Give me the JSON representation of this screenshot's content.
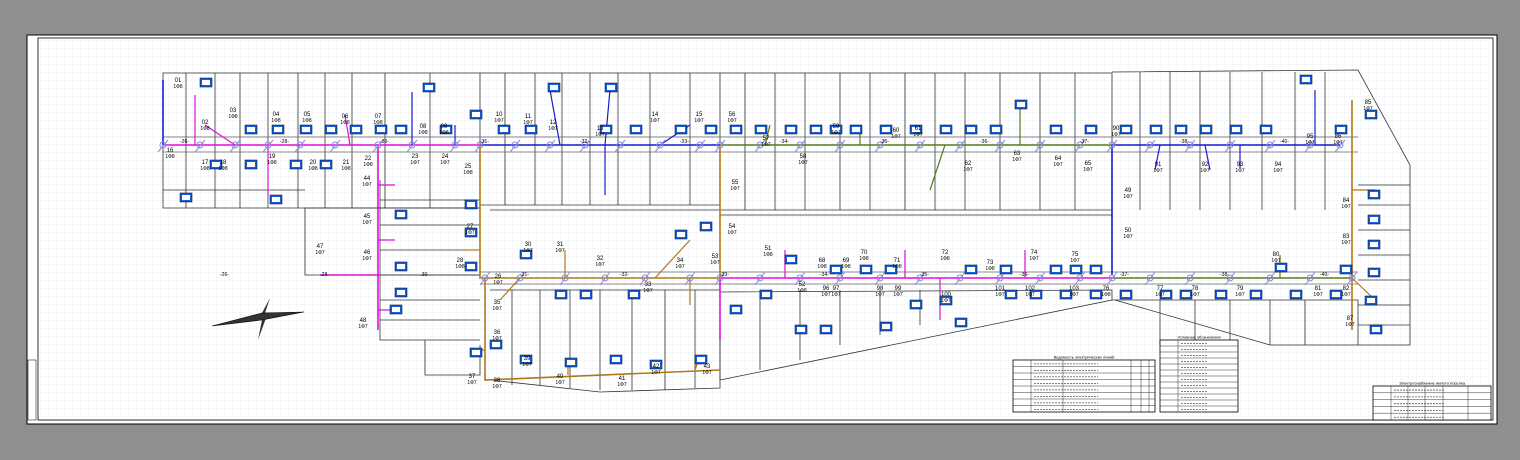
{
  "colors": {
    "background": "#8f8f8f",
    "sheet": "#ffffff",
    "grid": "#dfe6ee",
    "line_0_4kv_a": "#e010d8",
    "line_0_4kv_b": "#1a1ad0",
    "line_0_4kv_c": "#b07818",
    "line_0_4kv_d": "#5a7a1c",
    "meter_box": "#1560e0",
    "pole": "#8a8ad8"
  },
  "plots": {
    "top_left": [
      {
        "num": "01",
        "type": "1Ф8"
      },
      {
        "num": "02",
        "type": "1Ф8"
      },
      {
        "num": "03",
        "type": "1Ф8"
      },
      {
        "num": "04",
        "type": "1Ф8"
      },
      {
        "num": "05",
        "type": "1Ф8"
      },
      {
        "num": "06",
        "type": "1Ф8"
      },
      {
        "num": "07",
        "type": "1Ф8"
      },
      {
        "num": "08",
        "type": "1Ф8"
      },
      {
        "num": "09",
        "type": "1Ф8"
      },
      {
        "num": "10",
        "type": "1Ф7"
      },
      {
        "num": "11",
        "type": "1Ф7"
      },
      {
        "num": "12",
        "type": "1Ф7"
      },
      {
        "num": "13",
        "type": "1Ф7"
      },
      {
        "num": "14",
        "type": "1Ф7"
      },
      {
        "num": "15",
        "type": "1Ф7"
      }
    ],
    "mid_left": [
      {
        "num": "16",
        "type": "1Ф8"
      },
      {
        "num": "17",
        "type": "1Ф8"
      },
      {
        "num": "18",
        "type": "1Ф8"
      },
      {
        "num": "19",
        "type": "1Ф8"
      },
      {
        "num": "20",
        "type": "1Ф8"
      },
      {
        "num": "21",
        "type": "1Ф8"
      },
      {
        "num": "22",
        "type": "1Ф8"
      },
      {
        "num": "23",
        "type": "1Ф7"
      },
      {
        "num": "24",
        "type": "1Ф7"
      },
      {
        "num": "25",
        "type": "1Ф8"
      }
    ],
    "lower_left": [
      {
        "num": "44",
        "type": "1Ф7"
      },
      {
        "num": "45",
        "type": "1Ф7"
      },
      {
        "num": "46",
        "type": "1Ф7"
      },
      {
        "num": "47",
        "type": "1Ф7"
      },
      {
        "num": "48",
        "type": "1Ф7"
      },
      {
        "num": "27",
        "type": "1Ф7"
      },
      {
        "num": "28",
        "type": "1Ф8"
      },
      {
        "num": "26",
        "type": "1Ф7"
      },
      {
        "num": "30",
        "type": "1Ф7"
      },
      {
        "num": "31",
        "type": "1Ф7"
      },
      {
        "num": "32",
        "type": "1Ф7"
      },
      {
        "num": "33",
        "type": "1Ф7"
      },
      {
        "num": "34",
        "type": "1Ф7"
      },
      {
        "num": "35",
        "type": "1Ф7"
      },
      {
        "num": "36",
        "type": "1Ф7"
      },
      {
        "num": "37",
        "type": "1Ф7"
      },
      {
        "num": "38",
        "type": "1Ф7"
      },
      {
        "num": "39",
        "type": "1Ф7"
      },
      {
        "num": "40",
        "type": "1Ф7"
      },
      {
        "num": "41",
        "type": "1Ф7"
      },
      {
        "num": "42",
        "type": "1Ф7"
      },
      {
        "num": "43",
        "type": "1Ф7"
      }
    ],
    "right_top": [
      {
        "num": "56",
        "type": "1Ф7"
      },
      {
        "num": "57",
        "type": "1Ф7"
      },
      {
        "num": "58",
        "type": "1Ф7"
      },
      {
        "num": "59",
        "type": "1Ф7"
      },
      {
        "num": "60",
        "type": "1Ф7"
      },
      {
        "num": "61",
        "type": "1Ф7"
      },
      {
        "num": "62",
        "type": "1Ф7"
      },
      {
        "num": "63",
        "type": "1Ф7"
      },
      {
        "num": "64",
        "type": "1Ф7"
      },
      {
        "num": "65",
        "type": "1Ф7"
      },
      {
        "num": "90",
        "type": "1Ф7"
      },
      {
        "num": "91",
        "type": "1Ф7"
      },
      {
        "num": "92",
        "type": "1Ф7"
      },
      {
        "num": "93",
        "type": "1Ф7"
      },
      {
        "num": "94",
        "type": "1Ф7"
      },
      {
        "num": "95",
        "type": "1Ф7"
      },
      {
        "num": "86",
        "type": "1Ф7"
      },
      {
        "num": "85",
        "type": "1Ф7"
      }
    ],
    "right_bottom": [
      {
        "num": "51",
        "type": "1Ф8"
      },
      {
        "num": "52",
        "type": "1Ф8"
      },
      {
        "num": "68",
        "type": "1Ф8"
      },
      {
        "num": "69",
        "type": "1Ф8"
      },
      {
        "num": "70",
        "type": "1Ф8"
      },
      {
        "num": "71",
        "type": "1Ф8"
      },
      {
        "num": "72",
        "type": "1Ф8"
      },
      {
        "num": "73",
        "type": "1Ф8"
      },
      {
        "num": "74",
        "type": "1Ф7"
      },
      {
        "num": "75",
        "type": "1Ф7"
      },
      {
        "num": "76",
        "type": "1Ф8"
      },
      {
        "num": "77",
        "type": "1Ф7"
      },
      {
        "num": "78",
        "type": "1Ф7"
      },
      {
        "num": "79",
        "type": "1Ф7"
      },
      {
        "num": "80",
        "type": "1Ф7"
      },
      {
        "num": "81",
        "type": "1Ф7"
      },
      {
        "num": "82",
        "type": "1Ф7"
      },
      {
        "num": "83",
        "type": "1Ф7"
      },
      {
        "num": "84",
        "type": "1Ф7"
      },
      {
        "num": "87",
        "type": "1Ф7"
      },
      {
        "num": "96",
        "type": "1Ф7"
      },
      {
        "num": "97",
        "type": "1Ф7"
      },
      {
        "num": "98",
        "type": "1Ф7"
      },
      {
        "num": "99",
        "type": "1Ф7"
      },
      {
        "num": "100",
        "type": "1Ф7"
      },
      {
        "num": "101",
        "type": "1Ф7"
      },
      {
        "num": "102",
        "type": "1Ф7"
      },
      {
        "num": "103",
        "type": "1Ф7"
      },
      {
        "num": "53",
        "type": "1Ф7"
      },
      {
        "num": "54",
        "type": "1Ф7"
      },
      {
        "num": "55",
        "type": "1Ф7"
      },
      {
        "num": "49",
        "type": "1Ф7"
      },
      {
        "num": "50",
        "type": "1Ф7"
      }
    ]
  },
  "span_labels": [
    "-26-",
    "-28-",
    "-30-",
    "-31-",
    "-32-",
    "-33-",
    "-34-",
    "-35-",
    "-36-",
    "-37-",
    "-38-",
    "-40-"
  ],
  "tables": {
    "legend_title": "Условные обозначения",
    "spec_title": "Ведомость электрических линий",
    "stamp_title": "Электроснабжение жилого поселка"
  }
}
